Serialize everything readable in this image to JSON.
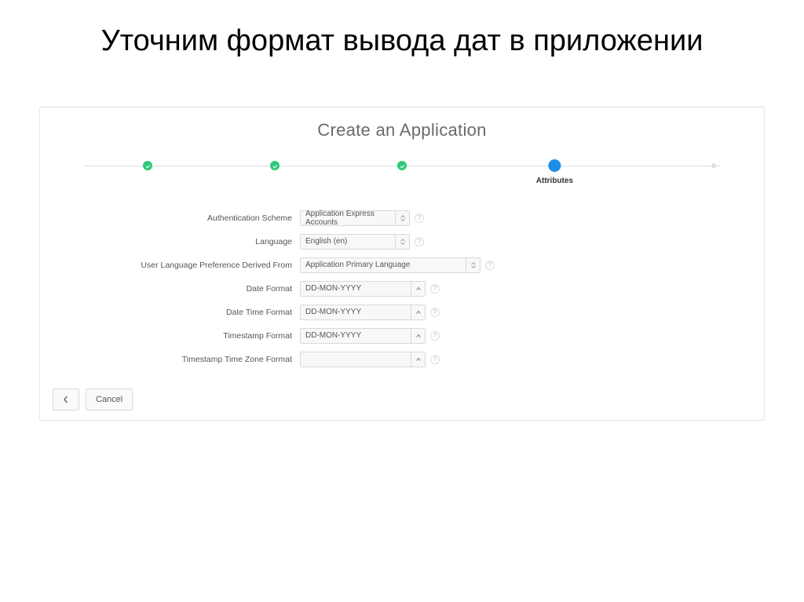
{
  "slide_title": "Уточним формат вывода дат в приложении",
  "wizard": {
    "title": "Create an Application",
    "active_step_label": "Attributes"
  },
  "form": {
    "auth_scheme": {
      "label": "Authentication Scheme",
      "value": "Application Express Accounts"
    },
    "language": {
      "label": "Language",
      "value": "English (en)"
    },
    "user_lang_pref": {
      "label": "User Language Preference Derived From",
      "value": "Application Primary Language"
    },
    "date_format": {
      "label": "Date Format",
      "value": "DD-MON-YYYY"
    },
    "date_time_format": {
      "label": "Date Time Format",
      "value": "DD-MON-YYYY"
    },
    "timestamp_format": {
      "label": "Timestamp Format",
      "value": "DD-MON-YYYY"
    },
    "timestamp_tz_format": {
      "label": "Timestamp Time Zone Format",
      "value": ""
    }
  },
  "footer": {
    "cancel": "Cancel"
  }
}
